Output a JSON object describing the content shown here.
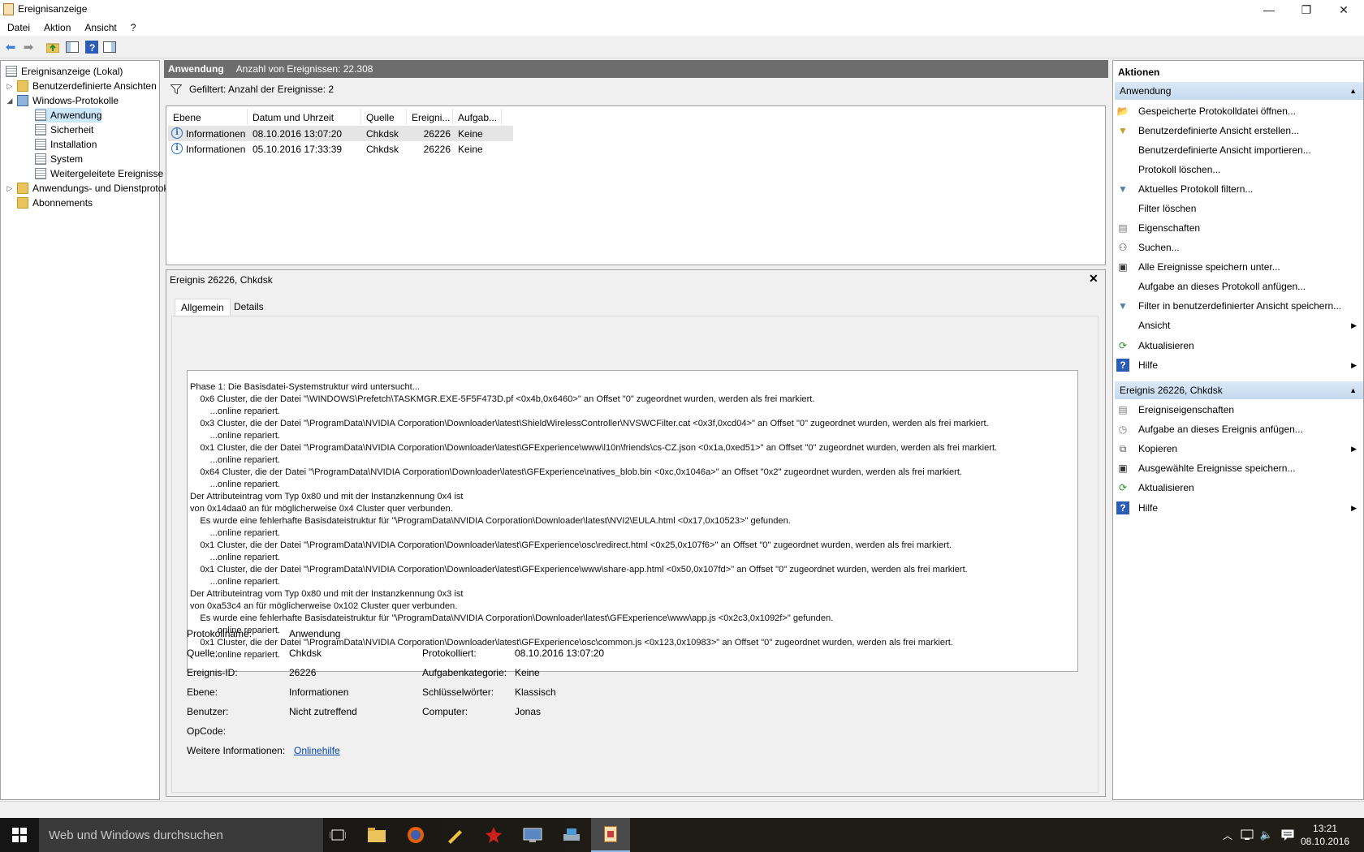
{
  "window": {
    "title": "Ereignisanzeige",
    "minimize": "—",
    "maximize": "❐",
    "close": "✕"
  },
  "menu": [
    "Datei",
    "Aktion",
    "Ansicht",
    "?"
  ],
  "tree": {
    "root": "Ereignisanzeige (Lokal)",
    "custom_views": "Benutzerdefinierte Ansichten",
    "windows_logs": "Windows-Protokolle",
    "items": [
      "Anwendung",
      "Sicherheit",
      "Installation",
      "System",
      "Weitergeleitete Ereignisse"
    ],
    "app_services": "Anwendungs- und Dienstprotokolle",
    "subscriptions": "Abonnements"
  },
  "header": {
    "title": "Anwendung",
    "count": "Anzahl von Ereignissen: 22.308"
  },
  "filter": {
    "text": "Gefiltert: Anzahl der Ereignisse: 2"
  },
  "columns": [
    "Ebene",
    "Datum und Uhrzeit",
    "Quelle",
    "Ereigni...",
    "Aufgab..."
  ],
  "rows": [
    {
      "level": "Informationen",
      "datetime": "08.10.2016 13:07:20",
      "source": "Chkdsk",
      "id": "26226",
      "task": "Keine"
    },
    {
      "level": "Informationen",
      "datetime": "05.10.2016 17:33:39",
      "source": "Chkdsk",
      "id": "26226",
      "task": "Keine"
    }
  ],
  "detail": {
    "title": "Ereignis 26226, Chkdsk",
    "tabs": [
      "Allgemein",
      "Details"
    ],
    "description": "Phase 1: Die Basisdatei-Systemstruktur wird untersucht...\n    0x6 Cluster, die der Datei \"\\WINDOWS\\Prefetch\\TASKMGR.EXE-5F5F473D.pf <0x4b,0x6460>\" an Offset \"0\" zugeordnet wurden, werden als frei markiert.\n        ...online repariert.\n    0x3 Cluster, die der Datei \"\\ProgramData\\NVIDIA Corporation\\Downloader\\latest\\ShieldWirelessController\\NVSWCFilter.cat <0x3f,0xcd04>\" an Offset \"0\" zugeordnet wurden, werden als frei markiert.\n        ...online repariert.\n    0x1 Cluster, die der Datei \"\\ProgramData\\NVIDIA Corporation\\Downloader\\latest\\GFExperience\\www\\l10n\\friends\\cs-CZ.json <0x1a,0xed51>\" an Offset \"0\" zugeordnet wurden, werden als frei markiert.\n        ...online repariert.\n    0x64 Cluster, die der Datei \"\\ProgramData\\NVIDIA Corporation\\Downloader\\latest\\GFExperience\\natives_blob.bin <0xc,0x1046a>\" an Offset \"0x2\" zugeordnet wurden, werden als frei markiert.\n        ...online repariert.\nDer Attributeintrag vom Typ 0x80 und mit der Instanzkennung 0x4 ist\nvon 0x14daa0 an für möglicherweise 0x4 Cluster quer verbunden.\n    Es wurde eine fehlerhafte Basisdateistruktur für \"\\ProgramData\\NVIDIA Corporation\\Downloader\\latest\\NVI2\\EULA.html <0x17,0x10523>\" gefunden.\n        ...online repariert.\n    0x1 Cluster, die der Datei \"\\ProgramData\\NVIDIA Corporation\\Downloader\\latest\\GFExperience\\osc\\redirect.html <0x25,0x107f6>\" an Offset \"0\" zugeordnet wurden, werden als frei markiert.\n        ...online repariert.\n    0x1 Cluster, die der Datei \"\\ProgramData\\NVIDIA Corporation\\Downloader\\latest\\GFExperience\\www\\share-app.html <0x50,0x107fd>\" an Offset \"0\" zugeordnet wurden, werden als frei markiert.\n        ...online repariert.\nDer Attributeintrag vom Typ 0x80 und mit der Instanzkennung 0x3 ist\nvon 0xa53c4 an für möglicherweise 0x102 Cluster quer verbunden.\n    Es wurde eine fehlerhafte Basisdateistruktur für \"\\ProgramData\\NVIDIA Corporation\\Downloader\\latest\\GFExperience\\www\\app.js <0x2c3,0x1092f>\" gefunden.\n        ...online repariert.\n    0x1 Cluster, die der Datei \"\\ProgramData\\NVIDIA Corporation\\Downloader\\latest\\GFExperience\\osc\\common.js <0x123,0x10983>\" an Offset \"0\" zugeordnet wurden, werden als frei markiert.\n        ...online repariert.",
    "labels": {
      "logname": "Protokollname:",
      "source": "Quelle:",
      "eventid": "Ereignis-ID:",
      "level": "Ebene:",
      "user": "Benutzer:",
      "opcode": "OpCode:",
      "moreinfo": "Weitere Informationen:",
      "logged": "Protokolliert:",
      "taskcat": "Aufgabenkategorie:",
      "keywords": "Schlüsselwörter:",
      "computer": "Computer:"
    },
    "values": {
      "logname": "Anwendung",
      "source": "Chkdsk",
      "eventid": "26226",
      "level": "Informationen",
      "user": "Nicht zutreffend",
      "opcode": "",
      "moreinfo": "Onlinehilfe",
      "logged": "08.10.2016 13:07:20",
      "taskcat": "Keine",
      "keywords": "Klassisch",
      "computer": "Jonas"
    }
  },
  "actions": {
    "title": "Aktionen",
    "section1": "Anwendung",
    "items1": [
      "Gespeicherte Protokolldatei öffnen...",
      "Benutzerdefinierte Ansicht erstellen...",
      "Benutzerdefinierte Ansicht importieren...",
      "Protokoll löschen...",
      "Aktuelles Protokoll filtern...",
      "Filter löschen",
      "Eigenschaften",
      "Suchen...",
      "Alle Ereignisse speichern unter...",
      "Aufgabe an dieses Protokoll anfügen...",
      "Filter in benutzerdefinierter Ansicht speichern...",
      "Ansicht",
      "Aktualisieren",
      "Hilfe"
    ],
    "section2": "Ereignis 26226, Chkdsk",
    "items2": [
      "Ereigniseigenschaften",
      "Aufgabe an dieses Ereignis anfügen...",
      "Kopieren",
      "Ausgewählte Ereignisse speichern...",
      "Aktualisieren",
      "Hilfe"
    ]
  },
  "taskbar": {
    "search_placeholder": "Web und Windows durchsuchen",
    "time": "13:21",
    "date": "08.10.2016"
  }
}
